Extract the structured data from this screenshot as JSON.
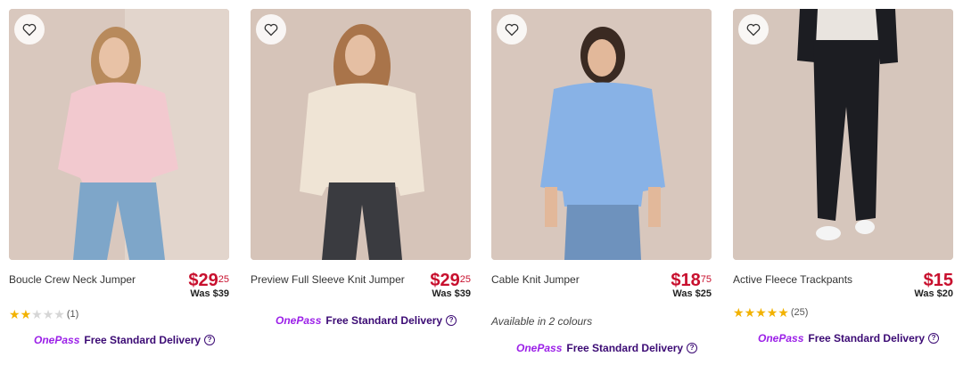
{
  "products": [
    {
      "name": "Boucle Crew Neck Jumper",
      "price_dollars": "$29",
      "price_cents": "25",
      "was_price": "Was $39",
      "rating": 2,
      "rating_max": 5,
      "review_count": "(1)",
      "image_colors": {
        "bg": "#d9c8be",
        "top": "#f2c9cf",
        "bottom": "#7ea6c9",
        "hair": "#b88a5c",
        "skin": "#e8c2a6"
      }
    },
    {
      "name": "Preview Full Sleeve Knit Jumper",
      "price_dollars": "$29",
      "price_cents": "25",
      "was_price": "Was $39",
      "image_colors": {
        "bg": "#d6c4b9",
        "top": "#efe4d5",
        "bottom": "#3a3b40",
        "hair": "#a9744a",
        "skin": "#e5bfa3"
      }
    },
    {
      "name": "Cable Knit Jumper",
      "price_dollars": "$18",
      "price_cents": "75",
      "was_price": "Was $25",
      "availability": "Available in 2 colours",
      "image_colors": {
        "bg": "#d8c7bd",
        "top": "#88b2e6",
        "bottom": "#6e92bd",
        "hair": "#3a2a22",
        "skin": "#e2b89a"
      }
    },
    {
      "name": "Active Fleece Trackpants",
      "price_dollars": "$15",
      "price_cents": "",
      "was_price": "Was $20",
      "rating": 5,
      "rating_max": 5,
      "review_count": "(25)",
      "image_colors": {
        "bg": "#d6c6bc",
        "top": "#e9e4df",
        "bottom": "#1c1d22",
        "hair": "#2a2a2a",
        "skin": "#e6c3a8"
      }
    }
  ],
  "onepass_label": "OnePass",
  "delivery_label": "Free Standard Delivery",
  "help_glyph": "?",
  "colors": {
    "price": "#c8102e",
    "onepass": "#9b1fe8",
    "delivery": "#3b0a74",
    "star_on": "#f2b200",
    "star_off": "#d6d6d6"
  }
}
